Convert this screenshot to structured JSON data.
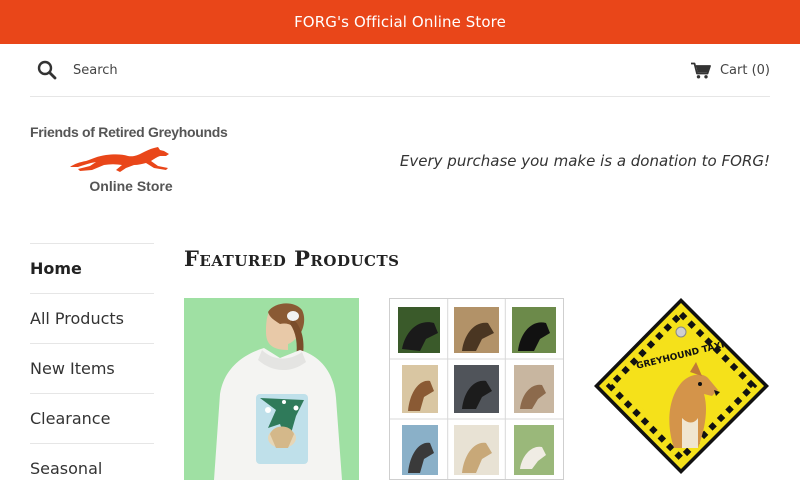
{
  "announcement": {
    "text": "FORG's Official Online Store"
  },
  "header": {
    "search_placeholder": "Search",
    "cart_label": "Cart (0)"
  },
  "logo": {
    "line1": "Friends of Retired Greyhounds",
    "line2": "Online Store"
  },
  "tagline": "Every purchase you make is a donation to FORG!",
  "nav": {
    "items": [
      {
        "label": "Home",
        "active": true
      },
      {
        "label": "All Products"
      },
      {
        "label": "New Items"
      },
      {
        "label": "Clearance"
      },
      {
        "label": "Seasonal"
      }
    ]
  },
  "featured": {
    "title": "Featured Products",
    "products": [
      {
        "image": "hoodie-photo"
      },
      {
        "image": "greyhound-photo-grid"
      },
      {
        "image": "greyhound-taxi-sign",
        "sign_text": "GREYHOUND TAXI"
      }
    ]
  },
  "colors": {
    "accent": "#e94619",
    "text": "#333333",
    "border": "#e6e6e6"
  },
  "icons": {
    "search": "search-icon",
    "cart": "cart-icon"
  }
}
